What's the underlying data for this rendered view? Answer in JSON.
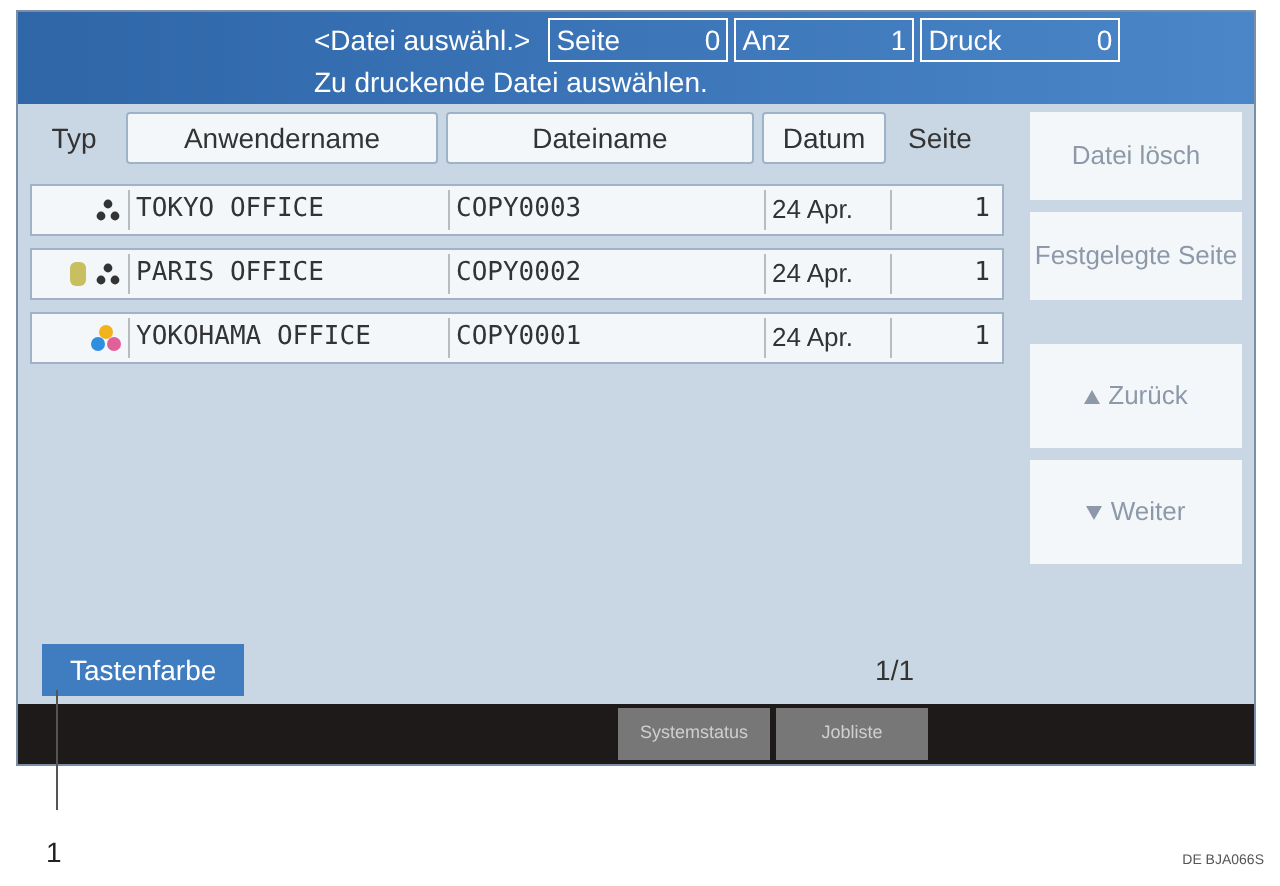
{
  "header": {
    "title": "<Datei auswähl.>",
    "subtitle": "Zu druckende Datei auswählen.",
    "counters": [
      {
        "label": "Seite",
        "value": "0"
      },
      {
        "label": "Anz",
        "value": "1"
      },
      {
        "label": "Druck",
        "value": "0"
      }
    ]
  },
  "table": {
    "columns": [
      {
        "label": "Typ",
        "kind": "plain"
      },
      {
        "label": "Anwendername",
        "kind": "button"
      },
      {
        "label": "Dateiname",
        "kind": "button"
      },
      {
        "label": "Datum",
        "kind": "button"
      },
      {
        "label": "Seite",
        "kind": "plain"
      }
    ],
    "rows": [
      {
        "kind": "mono",
        "secured": false,
        "user": "TOKYO OFFICE",
        "file": "COPY0003",
        "date": "24 Apr.",
        "pages": "1"
      },
      {
        "kind": "mono",
        "secured": true,
        "user": "PARIS OFFICE",
        "file": "COPY0002",
        "date": "24 Apr.",
        "pages": "1"
      },
      {
        "kind": "color",
        "secured": false,
        "user": "YOKOHAMA OFFICE",
        "file": "COPY0001",
        "date": "24 Apr.",
        "pages": "1"
      }
    ],
    "page_indicator": "1/1"
  },
  "side_buttons": [
    {
      "kind": "plain",
      "label": "Datei lösch",
      "disabled": true
    },
    {
      "kind": "plain",
      "label": "Festgelegte Seite",
      "disabled": true
    },
    {
      "kind": "up",
      "label": "Zurück",
      "disabled": true
    },
    {
      "kind": "down",
      "label": "Weiter",
      "disabled": true
    }
  ],
  "key_color_button": "Tastenfarbe",
  "bottom_buttons": [
    "Systemstatus",
    "Jobliste"
  ],
  "callout": "1",
  "figure_code": "DE BJA066S"
}
